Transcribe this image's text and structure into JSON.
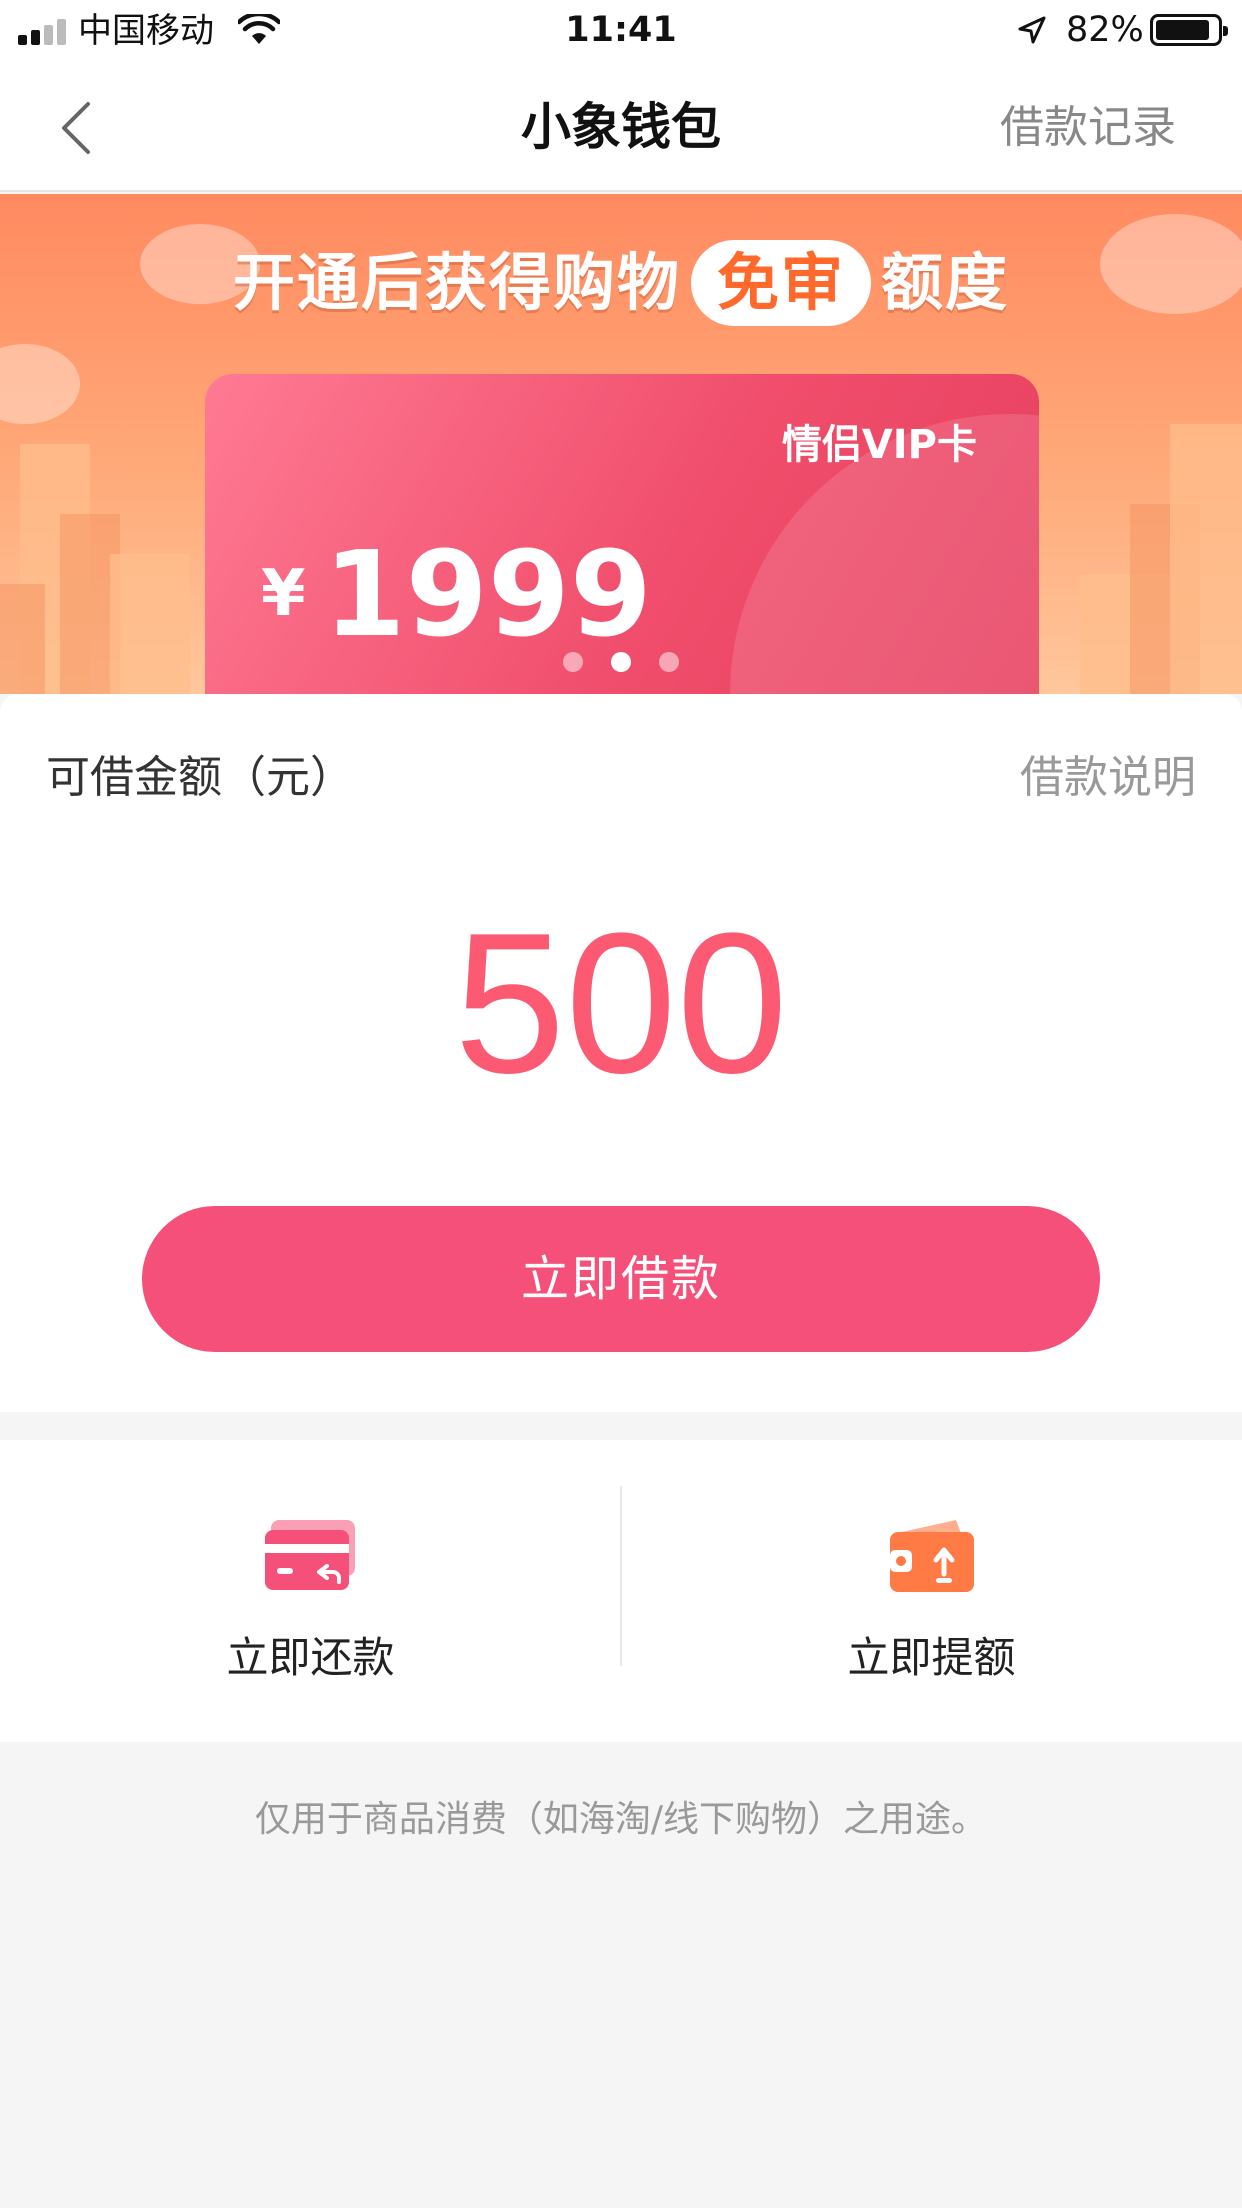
{
  "status_bar": {
    "carrier": "中国移动",
    "time": "11:41",
    "battery_percent": "82%"
  },
  "nav": {
    "title": "小象钱包",
    "right_link": "借款记录",
    "back_icon": "chevron-left-icon"
  },
  "banner": {
    "headline_before": "开通后获得购物",
    "headline_badge": "免审",
    "headline_after": "额度",
    "card_label": "情侣VIP卡",
    "card_currency": "¥",
    "card_amount": "1999",
    "carousel_count": 3,
    "carousel_active": 2
  },
  "loan": {
    "label": "可借金额（元）",
    "info_link": "借款说明",
    "amount": "500",
    "button_label": "立即借款"
  },
  "actions": [
    {
      "label": "立即还款",
      "icon": "repay-card-icon",
      "color": "#f5507a"
    },
    {
      "label": "立即提额",
      "icon": "wallet-upgrade-icon",
      "color": "#ff7a45"
    }
  ],
  "footnote": "仅用于商品消费（如海淘/线下购物）之用途。",
  "colors": {
    "accent": "#f5507a",
    "amount": "#fb5a72",
    "banner_orange": "#ff8a60"
  }
}
